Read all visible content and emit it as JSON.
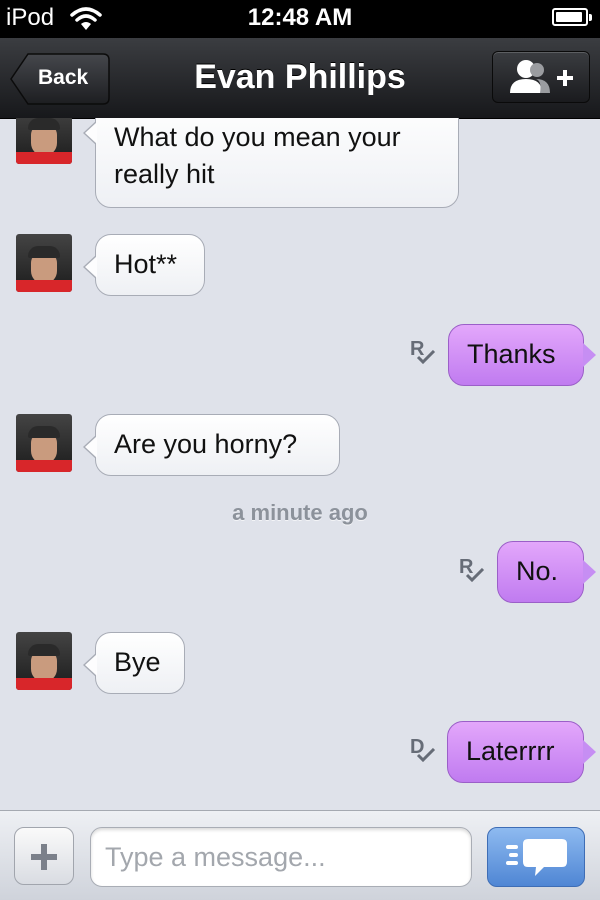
{
  "status_bar": {
    "carrier": "iPod",
    "time": "12:48 AM",
    "battery_level": 0.9
  },
  "nav": {
    "back_label": "Back",
    "title": "Evan Phillips",
    "add_contact_icon": "add-contact-icon"
  },
  "messages": [
    {
      "direction": "incoming",
      "text_line1": "What do you mean your",
      "text_line2": "really hit"
    },
    {
      "direction": "incoming",
      "text": "Hot**"
    },
    {
      "direction": "outgoing",
      "text": "Thanks",
      "receipt": "R"
    },
    {
      "direction": "incoming",
      "text": "Are you horny?"
    },
    {
      "direction": "outgoing",
      "text": "No.",
      "receipt": "R"
    },
    {
      "direction": "incoming",
      "text": "Bye"
    },
    {
      "direction": "outgoing",
      "text": "Laterrrr",
      "receipt": "D"
    }
  ],
  "timestamp": "a minute ago",
  "composer": {
    "placeholder": "Type a message...",
    "value": "",
    "attach_icon": "plus-icon",
    "send_icon": "send-chat-icon"
  },
  "colors": {
    "outgoing_bubble": "#d08ff6",
    "incoming_bubble": "#f7f8fa",
    "background": "#dfe2ea",
    "send_button": "#5b8fd8"
  }
}
